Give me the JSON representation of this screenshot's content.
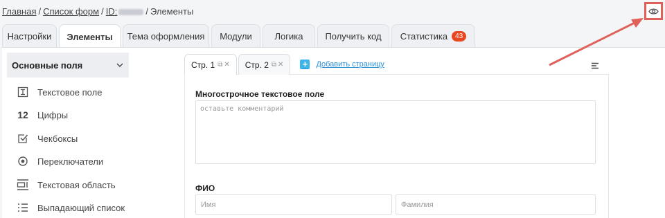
{
  "breadcrumb": {
    "home": "Главная",
    "forms": "Список форм",
    "id_label": "ID:",
    "separator": "/",
    "current": "Элементы"
  },
  "preview_icon": "eye-icon",
  "tabs": [
    {
      "label": "Настройки",
      "active": false
    },
    {
      "label": "Элементы",
      "active": true
    },
    {
      "label": "Тема оформления",
      "active": false
    },
    {
      "label": "Модули",
      "active": false
    },
    {
      "label": "Логика",
      "active": false
    },
    {
      "label": "Получить код",
      "active": false
    },
    {
      "label": "Статистика",
      "active": false,
      "badge": "43"
    }
  ],
  "sidebar": {
    "header": "Основные поля",
    "items": [
      {
        "label": "Текстовое поле",
        "icon": "text-cursor-icon"
      },
      {
        "label": "Цифры",
        "icon": "numbers-icon",
        "icon_text": "12"
      },
      {
        "label": "Чекбоксы",
        "icon": "checkbox-icon"
      },
      {
        "label": "Переключатели",
        "icon": "radio-icon"
      },
      {
        "label": "Текстовая область",
        "icon": "textarea-icon"
      },
      {
        "label": "Выпадающий список",
        "icon": "list-icon"
      }
    ]
  },
  "page_tabs": [
    {
      "label": "Стр. 1",
      "active": true
    },
    {
      "label": "Стр. 2",
      "active": false
    }
  ],
  "add_page": "Добавить страницу",
  "form": {
    "textarea_label": "Многострочное текстовое поле",
    "textarea_placeholder": "оставьте комментарий",
    "name_label": "ФИО",
    "first_name_placeholder": "Имя",
    "last_name_placeholder": "Фамилия"
  },
  "colors": {
    "accent": "#3fb4ea",
    "badge": "#e8481f",
    "highlight": "#e0605a"
  }
}
